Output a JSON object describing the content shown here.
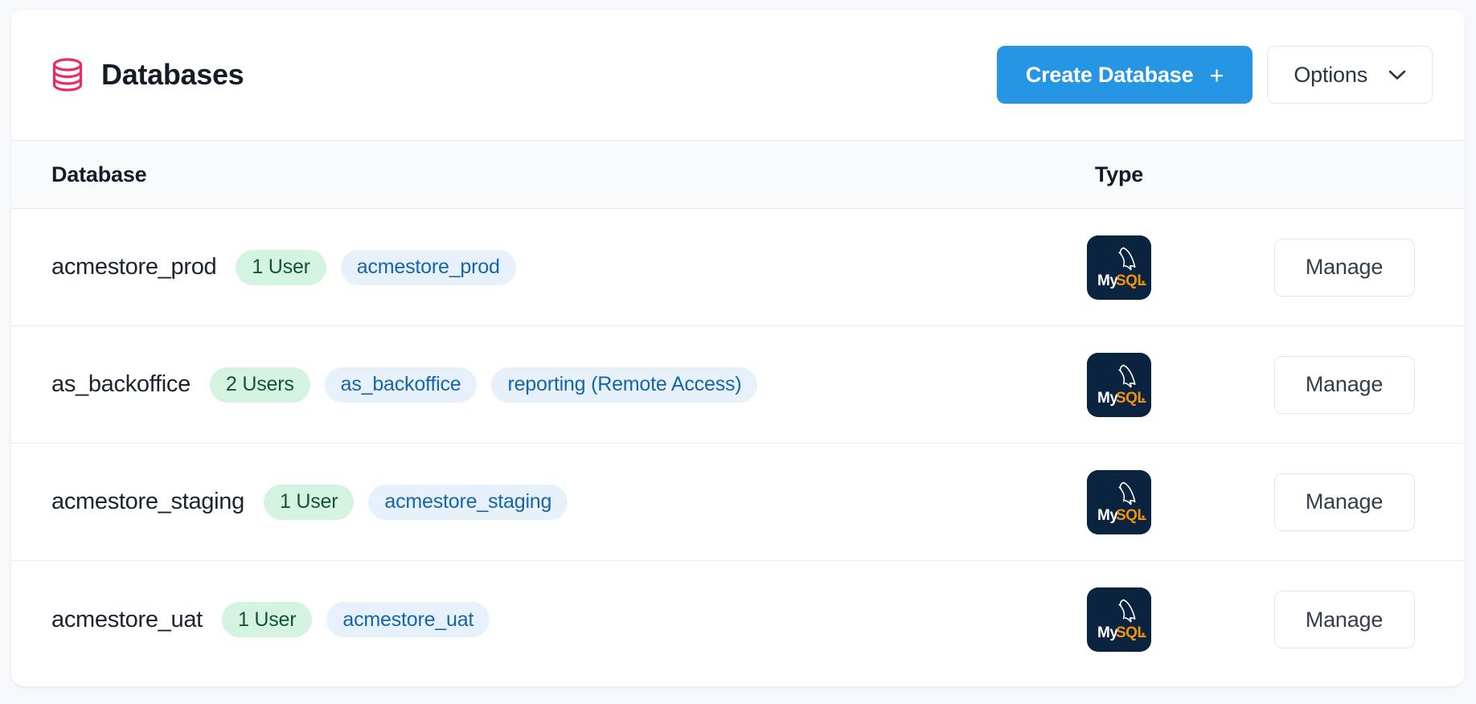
{
  "header": {
    "icon": "database-cylinder-icon",
    "title": "Databases",
    "create_button": {
      "label": "Create Database",
      "icon": "plus-icon",
      "color": "#2596e3"
    },
    "options_button": {
      "label": "Options",
      "icon": "chevron-down-icon"
    }
  },
  "table": {
    "columns": {
      "database": "Database",
      "type": "Type"
    },
    "rows": [
      {
        "name": "acmestore_prod",
        "users_badge": "1 User",
        "user_badges": [
          "acmestore_prod"
        ],
        "type_icon": "mysql-logo-icon",
        "type_label": "MySQL",
        "type_label_primary": "My",
        "type_label_accent": "SQL",
        "action": "Manage"
      },
      {
        "name": "as_backoffice",
        "users_badge": "2 Users",
        "user_badges": [
          "as_backoffice",
          "reporting (Remote Access)"
        ],
        "type_icon": "mysql-logo-icon",
        "type_label": "MySQL",
        "type_label_primary": "My",
        "type_label_accent": "SQL",
        "action": "Manage"
      },
      {
        "name": "acmestore_staging",
        "users_badge": "1 User",
        "user_badges": [
          "acmestore_staging"
        ],
        "type_icon": "mysql-logo-icon",
        "type_label": "MySQL",
        "type_label_primary": "My",
        "type_label_accent": "SQL",
        "action": "Manage"
      },
      {
        "name": "acmestore_uat",
        "users_badge": "1 User",
        "user_badges": [
          "acmestore_uat"
        ],
        "type_icon": "mysql-logo-icon",
        "type_label": "MySQL",
        "type_label_primary": "My",
        "type_label_accent": "SQL",
        "action": "Manage"
      }
    ]
  },
  "colors": {
    "page_background": "#f6f8fb",
    "card_background": "#ffffff",
    "accent_primary": "#2596e3",
    "title_icon": "#ec2a63",
    "badge_users_bg": "#d4f4e1",
    "badge_users_text": "#145239",
    "badge_user_bg": "#e7f1fc",
    "badge_user_text": "#1565a8",
    "mysql_tile": "#0a2440",
    "mysql_accent": "#f29111"
  }
}
